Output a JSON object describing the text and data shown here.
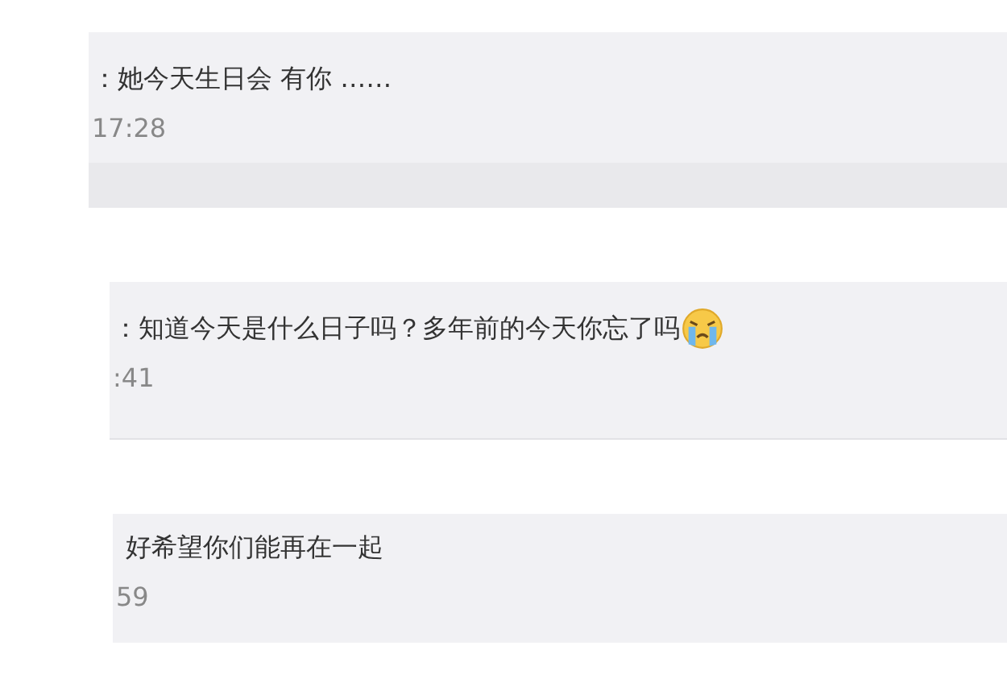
{
  "comments": [
    {
      "text": "：她今天生日会 有你 ……",
      "time": "17:28",
      "emoji": false,
      "reply_bar": true
    },
    {
      "text": "：知道今天是什么日子吗？多年前的今天你忘了吗",
      "time": ":41",
      "emoji": true,
      "reply_bar": false
    },
    {
      "text": "好希望你们能再在一起",
      "time": "59",
      "emoji": false,
      "reply_bar": false
    }
  ]
}
